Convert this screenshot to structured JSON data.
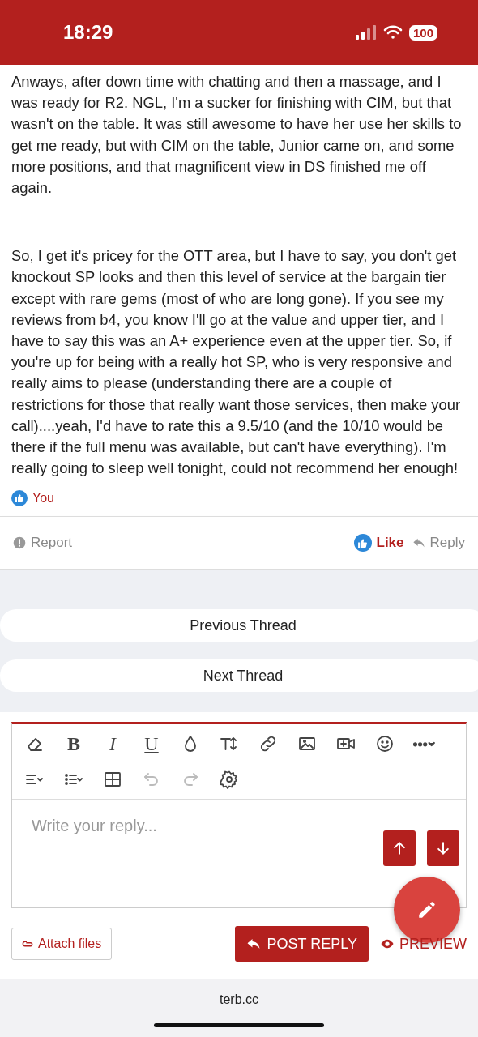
{
  "status_bar": {
    "time": "18:29",
    "battery": "100"
  },
  "post": {
    "paragraphs": [
      "Anways, after down time with chatting and then a massage, and I was ready for R2. NGL, I'm a sucker for finishing with CIM, but that wasn't on the table. It was still awesome to have her use her skills to get me ready, but with CIM on the table, Junior came on, and some more positions, and that magnificent view in DS finished me off again.",
      "So, I get it's pricey for the OTT area, but I have to say, you don't get knockout SP looks and then this level of service at the bargain tier except with rare gems (most of who are long gone). If you see my reviews from b4, you know I'll go at the value and upper tier, and I have to say this was an A+ experience even at the upper tier. So, if you're up for being with a really hot SP, who is very responsive and really aims to please (understanding there are a couple of restrictions for those that really want those services, then make your call)....yeah, I'd have to rate this a 9.5/10 (and the 10/10 would be there if the full menu was available, but can't have everything). I'm really going to sleep well tonight, could not recommend her enough!"
    ],
    "reactions": "You",
    "actions": {
      "report": "Report",
      "like": "Like",
      "liked": true,
      "reply": "Reply"
    }
  },
  "thread_nav": [
    "Previous Thread",
    "Next Thread"
  ],
  "editor": {
    "toolbar": [
      {
        "kind": "eraser",
        "disabled": false
      },
      {
        "kind": "text",
        "label": "B",
        "disabled": false
      },
      {
        "kind": "text",
        "label": "I",
        "disabled": false
      },
      {
        "kind": "text",
        "label": "U",
        "disabled": false
      },
      {
        "kind": "droplet",
        "disabled": false
      },
      {
        "kind": "textsize",
        "disabled": false
      },
      {
        "kind": "link",
        "disabled": false
      },
      {
        "kind": "image",
        "disabled": false
      },
      {
        "kind": "video",
        "disabled": false
      },
      {
        "kind": "smiley",
        "disabled": false
      },
      {
        "kind": "more",
        "disabled": false
      },
      {
        "kind": "align",
        "disabled": false
      },
      {
        "kind": "list",
        "disabled": false
      },
      {
        "kind": "table",
        "disabled": false
      },
      {
        "kind": "undo",
        "disabled": true
      },
      {
        "kind": "redo",
        "disabled": true
      },
      {
        "kind": "gear",
        "disabled": false
      }
    ],
    "placeholder": "Write your reply...",
    "attach": "Attach files",
    "post_reply": "POST REPLY",
    "preview": "PREVIEW"
  },
  "footer": {
    "address": "terb.cc"
  }
}
